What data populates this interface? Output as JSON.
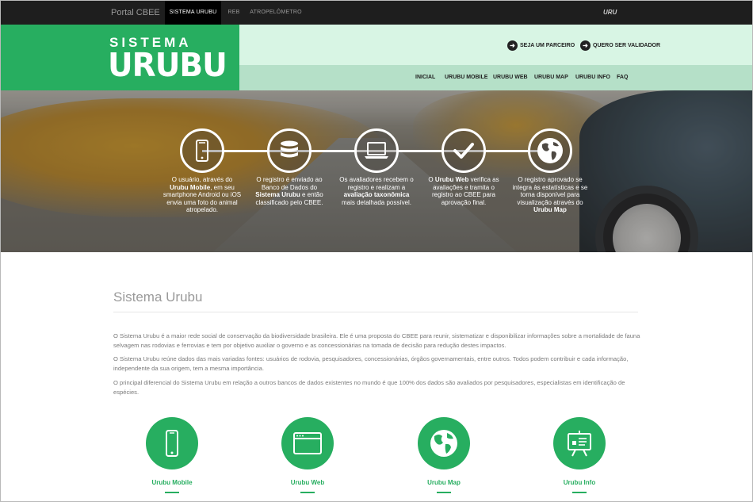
{
  "topbar": {
    "brand": "Portal CBEE",
    "tabs": [
      "SISTEMA URUBU",
      "REB",
      "ATROPELÔMETRO"
    ],
    "logo_text": "URU"
  },
  "header": {
    "logo_top": "SISTEMA",
    "logo_main": "URUBU",
    "cta": [
      "SEJA UM PARCEIRO",
      "QUERO SER VALIDADOR"
    ],
    "nav": [
      "INICIAL",
      "URUBU MOBILE",
      "URUBU WEB",
      "URUBU MAP",
      "URUBU INFO",
      "FAQ"
    ]
  },
  "hero": {
    "steps": [
      {
        "icon": "smartphone-icon",
        "pre": "O usuário, através do ",
        "bold": "Urubu Mobile",
        "post": ", em seu smartphone Android ou iOS envia uma foto do animal atropelado."
      },
      {
        "icon": "database-icon",
        "pre": "O registro é enviado ao Banco de Dados do ",
        "bold": "Sistema Urubu",
        "post": " e então classificado pelo CBEE."
      },
      {
        "icon": "laptop-icon",
        "pre": "Os avaliadores recebem o registro e realizam a ",
        "bold": "avaliação taxonômica",
        "post": " mais detalhada possível."
      },
      {
        "icon": "check-icon",
        "pre": "O ",
        "bold": "Urubu Web",
        "post": " verifica as avaliações e tramita o registro ao CBEE para aprovação final."
      },
      {
        "icon": "globe-icon",
        "pre": "O registro aprovado se integra às estatísticas e se torna disponível para visualização através do ",
        "bold": "Urubu Map",
        "post": ""
      }
    ]
  },
  "content": {
    "title": "Sistema Urubu",
    "paragraphs": [
      "O Sistema Urubu é a maior rede social de conservação da biodiversidade brasileira. Ele é uma proposta do CBEE para reunir, sistematizar e disponibilizar informações sobre a mortalidade de fauna selvagem nas rodovias e ferrovias e tem por objetivo auxiliar o governo e as concessionárias na tomada de decisão para redução destes impactos.",
      "O Sistema Urubu reúne dados das mais variadas fontes: usuários de rodovia, pesquisadores, concessionárias, órgãos governamentais, entre outros. Todos podem contribuir e cada informação, independente da sua origem, tem a mesma importância.",
      "O principal diferencial do Sistema Urubu em relação a outros bancos de dados existentes no mundo é que 100% dos dados são avaliados por pesquisadores, especialistas em identificação de espécies."
    ],
    "features": [
      {
        "label": "Urubu Mobile",
        "icon": "smartphone-icon"
      },
      {
        "label": "Urubu Web",
        "icon": "browser-window-icon"
      },
      {
        "label": "Urubu Map",
        "icon": "globe-icon"
      },
      {
        "label": "Urubu Info",
        "icon": "presentation-chart-icon"
      }
    ]
  },
  "colors": {
    "brand_green": "#27ae60",
    "header_light": "#d8f5e4",
    "nav_bg": "#b5e0c8",
    "topbar": "#1e1e1e"
  }
}
